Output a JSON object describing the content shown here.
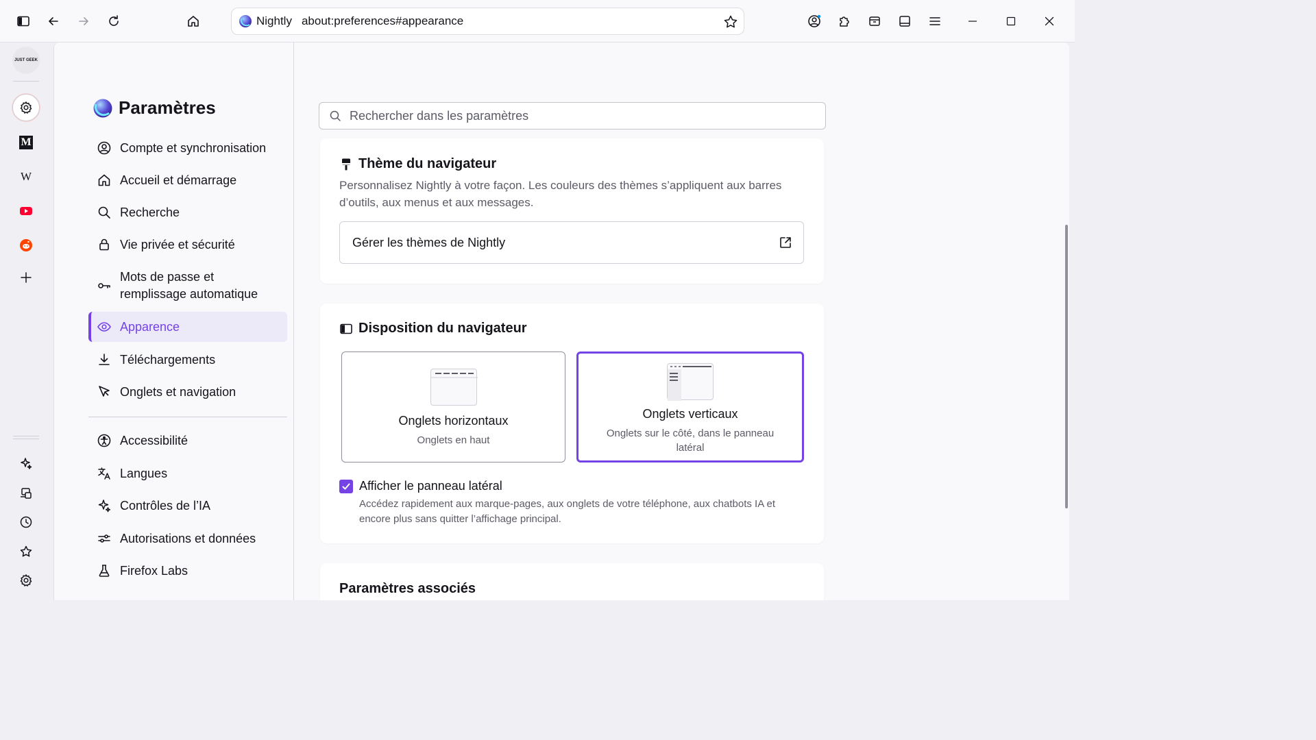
{
  "toolbar": {
    "brand": "Nightly",
    "url": "about:preferences#appearance"
  },
  "sidebar_rail": {
    "items": [
      {
        "name": "justgeek-site",
        "label": "JUST GEEK"
      },
      {
        "name": "settings"
      },
      {
        "name": "le-monde",
        "label": "M"
      },
      {
        "name": "wikipedia",
        "label": "W"
      },
      {
        "name": "youtube"
      },
      {
        "name": "reddit"
      },
      {
        "name": "add"
      }
    ]
  },
  "settings": {
    "title": "Paramètres",
    "categories": [
      {
        "label": "Compte et synchronisation",
        "icon": "account-icon"
      },
      {
        "label": "Accueil et démarrage",
        "icon": "home-icon"
      },
      {
        "label": "Recherche",
        "icon": "search-icon"
      },
      {
        "label": "Vie privée et sécurité",
        "icon": "lock-icon"
      },
      {
        "label": "Mots de passe et remplissage automatique",
        "icon": "key-icon"
      },
      {
        "label": "Apparence",
        "icon": "eye-icon",
        "selected": true
      },
      {
        "label": "Téléchargements",
        "icon": "download-icon"
      },
      {
        "label": "Onglets et navigation",
        "icon": "cursor-icon"
      },
      {
        "label": "Accessibilité",
        "icon": "accessibility-icon"
      },
      {
        "label": "Langues",
        "icon": "translate-icon"
      },
      {
        "label": "Contrôles de l’IA",
        "icon": "sparkle-icon"
      },
      {
        "label": "Autorisations et données",
        "icon": "permissions-icon"
      },
      {
        "label": "Firefox Labs",
        "icon": "flask-icon"
      }
    ]
  },
  "search": {
    "placeholder": "Rechercher dans les paramètres"
  },
  "theme_card": {
    "title": "Thème du navigateur",
    "description": "Personnalisez Nightly à votre façon. Les couleurs des thèmes s’appliquent aux barres d’outils, aux menus et aux messages.",
    "manage_label": "Gérer les thèmes de Nightly"
  },
  "layout_card": {
    "title": "Disposition du navigateur",
    "options": [
      {
        "title": "Onglets horizontaux",
        "subtitle": "Onglets en haut",
        "selected": false
      },
      {
        "title": "Onglets verticaux",
        "subtitle": "Onglets sur le côté, dans le panneau latéral",
        "selected": true
      }
    ],
    "checkbox_label": "Afficher le panneau latéral",
    "checkbox_checked": true,
    "checkbox_desc": "Accédez rapidement aux marque-pages, aux onglets de votre téléphone, aux chatbots IA et encore plus sans quitter l’affichage principal."
  },
  "related_card": {
    "title": "Paramètres associés"
  },
  "colors": {
    "accent": "#7542e5",
    "selected_bg": "#ece9f8",
    "text": "#15141a",
    "muted": "#5b5b66"
  }
}
